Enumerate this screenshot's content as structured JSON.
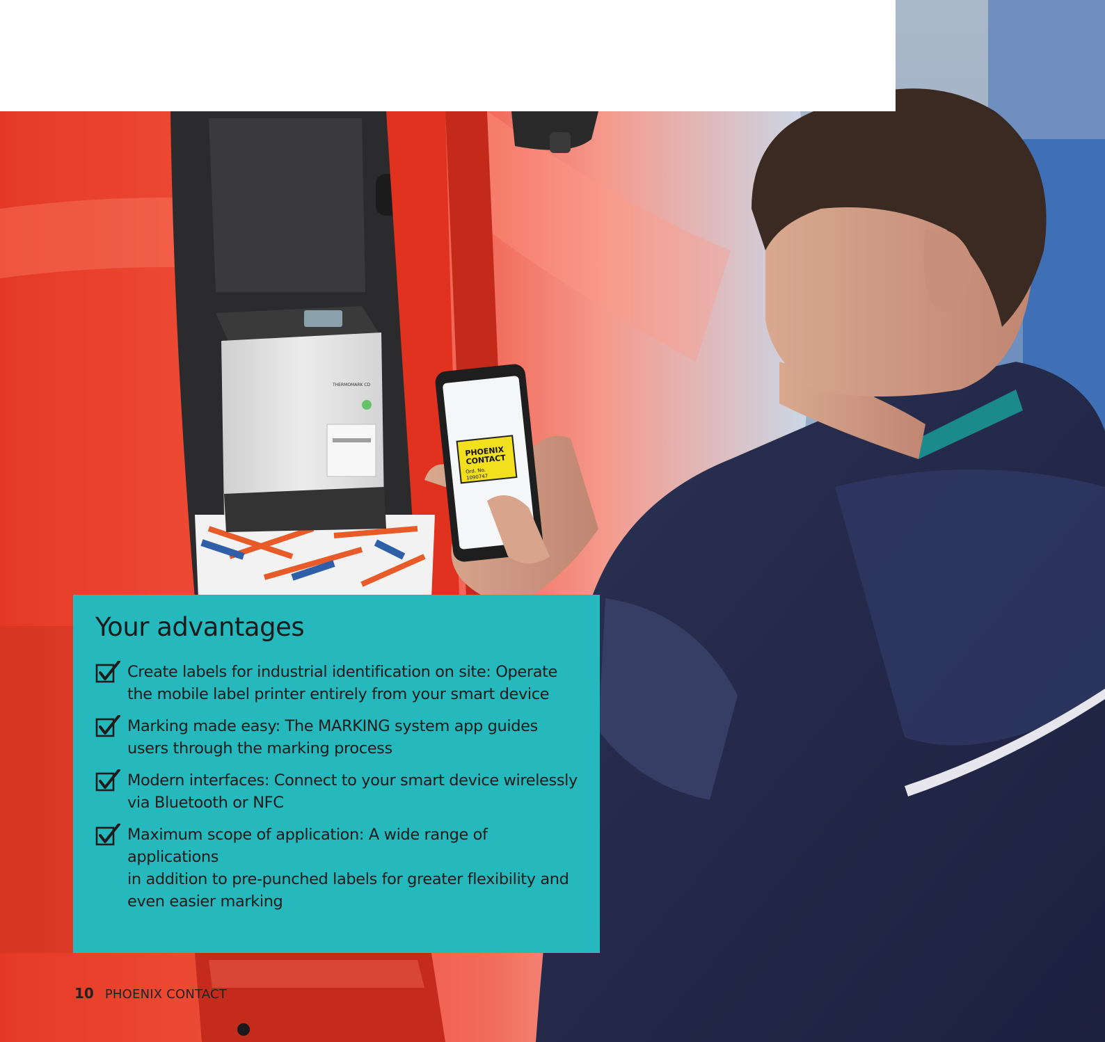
{
  "advantages": {
    "title": "Your advantages",
    "items": [
      {
        "lines": [
          "Create labels for industrial identification on site: Operate",
          "the mobile label printer entirely from your smart device"
        ]
      },
      {
        "lines": [
          "Marking made easy: The MARKING system app guides",
          "users through the marking process"
        ]
      },
      {
        "lines": [
          "Modern interfaces: Connect to your smart device wirelessly",
          "via Bluetooth or NFC"
        ]
      },
      {
        "lines": [
          "Maximum scope of application: A wide range of applications",
          "in addition to pre-punched labels for greater flexibility and",
          "even easier marking"
        ]
      }
    ],
    "check_icon": "checked-box-icon",
    "box_color": "#25b8bc"
  },
  "photo": {
    "label_sticker": [
      "PHOENIX",
      "CONTACT",
      "Ord. No.",
      "1090747"
    ],
    "printer_brand": "THERMOMARK CD"
  },
  "footer": {
    "page_number": "10",
    "brand": "PHOENIX CONTACT"
  }
}
